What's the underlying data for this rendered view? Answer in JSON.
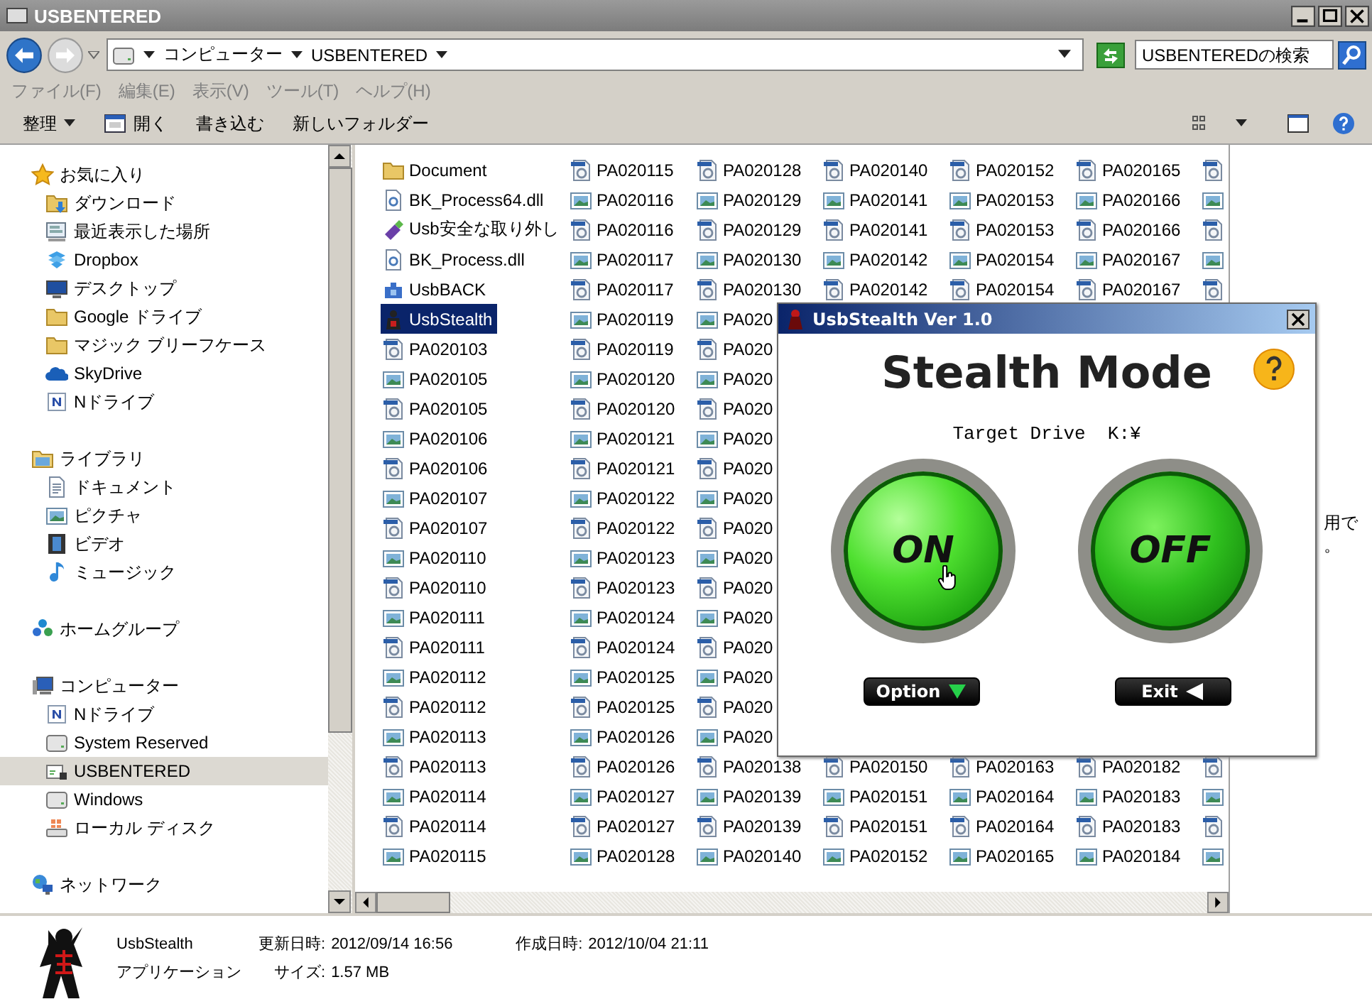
{
  "window": {
    "title": "USBENTERED"
  },
  "address": {
    "crumbs": [
      "コンピューター",
      "USBENTERED"
    ]
  },
  "search": {
    "placeholder": "USBENTEREDの検索"
  },
  "menu": [
    "ファイル(F)",
    "編集(E)",
    "表示(V)",
    "ツール(T)",
    "ヘルプ(H)"
  ],
  "toolbar": [
    {
      "label": "整理",
      "kind": "dropdown"
    },
    {
      "label": "開く",
      "kind": "open"
    },
    {
      "label": "書き込む",
      "kind": "plain"
    },
    {
      "label": "新しいフォルダー",
      "kind": "plain"
    }
  ],
  "sidebar": {
    "groups": [
      {
        "label": "お気に入り",
        "kind": "star",
        "selected": false,
        "children": [
          {
            "label": "ダウンロード",
            "kind": "download",
            "selected": false
          },
          {
            "label": "最近表示した場所",
            "kind": "recent",
            "selected": false
          },
          {
            "label": "Dropbox",
            "kind": "box",
            "selected": false
          },
          {
            "label": "デスクトップ",
            "kind": "desktop",
            "selected": false
          },
          {
            "label": "Google ドライブ",
            "kind": "folder",
            "selected": false
          },
          {
            "label": "マジック ブリーフケース",
            "kind": "folder",
            "selected": false
          },
          {
            "label": "SkyDrive",
            "kind": "cloud",
            "selected": false
          },
          {
            "label": "Nドライブ",
            "kind": "ndrive",
            "selected": false
          }
        ]
      },
      {
        "label": "ライブラリ",
        "kind": "library",
        "selected": false,
        "children": [
          {
            "label": "ドキュメント",
            "kind": "document",
            "selected": false
          },
          {
            "label": "ピクチャ",
            "kind": "picture",
            "selected": false
          },
          {
            "label": "ビデオ",
            "kind": "video",
            "selected": false
          },
          {
            "label": "ミュージック",
            "kind": "music",
            "selected": false
          }
        ]
      },
      {
        "label": "ホームグループ",
        "kind": "homegroup",
        "selected": false
      },
      {
        "label": "コンピューター",
        "kind": "computer",
        "selected": false,
        "children": [
          {
            "label": "Nドライブ",
            "kind": "ndrive",
            "selected": false
          },
          {
            "label": "System Reserved",
            "kind": "drive",
            "selected": false
          },
          {
            "label": "USBENTERED",
            "kind": "usbdrive",
            "selected": true
          },
          {
            "label": "Windows",
            "kind": "drive",
            "selected": false
          },
          {
            "label": "ローカル ディスク",
            "kind": "localdisk",
            "selected": false
          }
        ]
      },
      {
        "label": "ネットワーク",
        "kind": "network",
        "selected": false
      }
    ]
  },
  "files": {
    "columns": [
      {
        "items": [
          {
            "name": "Document",
            "kind": "folder",
            "selected": false
          },
          {
            "name": "BK_Process64.dll",
            "kind": "dll",
            "selected": false
          },
          {
            "name": "Usb安全な取り外し",
            "kind": "usb",
            "selected": false
          },
          {
            "name": "BK_Process.dll",
            "kind": "dll",
            "selected": false
          },
          {
            "name": "UsbBACK",
            "kind": "app",
            "selected": false
          },
          {
            "name": "UsbStealth",
            "kind": "ninja",
            "selected": true
          },
          {
            "name": "PA020103",
            "kind": "camera",
            "selected": false
          },
          {
            "name": "PA020105",
            "kind": "picture",
            "selected": false
          },
          {
            "name": "PA020105",
            "kind": "camera",
            "selected": false
          },
          {
            "name": "PA020106",
            "kind": "picture",
            "selected": false
          },
          {
            "name": "PA020106",
            "kind": "camera",
            "selected": false
          },
          {
            "name": "PA020107",
            "kind": "picture",
            "selected": false
          },
          {
            "name": "PA020107",
            "kind": "camera",
            "selected": false
          },
          {
            "name": "PA020110",
            "kind": "picture",
            "selected": false
          },
          {
            "name": "PA020110",
            "kind": "camera",
            "selected": false
          },
          {
            "name": "PA020111",
            "kind": "picture",
            "selected": false
          },
          {
            "name": "PA020111",
            "kind": "camera",
            "selected": false
          },
          {
            "name": "PA020112",
            "kind": "picture",
            "selected": false
          },
          {
            "name": "PA020112",
            "kind": "camera",
            "selected": false
          },
          {
            "name": "PA020113",
            "kind": "picture",
            "selected": false
          },
          {
            "name": "PA020113",
            "kind": "camera",
            "selected": false
          },
          {
            "name": "PA020114",
            "kind": "picture",
            "selected": false
          },
          {
            "name": "PA020114",
            "kind": "camera",
            "selected": false
          },
          {
            "name": "PA020115",
            "kind": "picture",
            "selected": false
          }
        ]
      },
      {
        "items": [
          {
            "name": "PA020115",
            "kind": "camera",
            "selected": false
          },
          {
            "name": "PA020116",
            "kind": "picture",
            "selected": false
          },
          {
            "name": "PA020116",
            "kind": "camera",
            "selected": false
          },
          {
            "name": "PA020117",
            "kind": "picture",
            "selected": false
          },
          {
            "name": "PA020117",
            "kind": "camera",
            "selected": false
          },
          {
            "name": "PA020119",
            "kind": "picture",
            "selected": false
          },
          {
            "name": "PA020119",
            "kind": "camera",
            "selected": false
          },
          {
            "name": "PA020120",
            "kind": "picture",
            "selected": false
          },
          {
            "name": "PA020120",
            "kind": "camera",
            "selected": false
          },
          {
            "name": "PA020121",
            "kind": "picture",
            "selected": false
          },
          {
            "name": "PA020121",
            "kind": "camera",
            "selected": false
          },
          {
            "name": "PA020122",
            "kind": "picture",
            "selected": false
          },
          {
            "name": "PA020122",
            "kind": "camera",
            "selected": false
          },
          {
            "name": "PA020123",
            "kind": "picture",
            "selected": false
          },
          {
            "name": "PA020123",
            "kind": "camera",
            "selected": false
          },
          {
            "name": "PA020124",
            "kind": "picture",
            "selected": false
          },
          {
            "name": "PA020124",
            "kind": "camera",
            "selected": false
          },
          {
            "name": "PA020125",
            "kind": "picture",
            "selected": false
          },
          {
            "name": "PA020125",
            "kind": "camera",
            "selected": false
          },
          {
            "name": "PA020126",
            "kind": "picture",
            "selected": false
          },
          {
            "name": "PA020126",
            "kind": "camera",
            "selected": false
          },
          {
            "name": "PA020127",
            "kind": "picture",
            "selected": false
          },
          {
            "name": "PA020127",
            "kind": "camera",
            "selected": false
          },
          {
            "name": "PA020128",
            "kind": "picture",
            "selected": false
          }
        ]
      },
      {
        "items": [
          {
            "name": "PA020128",
            "kind": "camera",
            "selected": false
          },
          {
            "name": "PA020129",
            "kind": "picture",
            "selected": false
          },
          {
            "name": "PA020129",
            "kind": "camera",
            "selected": false
          },
          {
            "name": "PA020130",
            "kind": "picture",
            "selected": false
          },
          {
            "name": "PA020130",
            "kind": "camera",
            "selected": false
          },
          {
            "name": "PA020",
            "kind": "picture",
            "selected": false
          },
          {
            "name": "PA020",
            "kind": "camera",
            "selected": false
          },
          {
            "name": "PA020",
            "kind": "picture",
            "selected": false
          },
          {
            "name": "PA020",
            "kind": "camera",
            "selected": false
          },
          {
            "name": "PA020",
            "kind": "picture",
            "selected": false
          },
          {
            "name": "PA020",
            "kind": "camera",
            "selected": false
          },
          {
            "name": "PA020",
            "kind": "picture",
            "selected": false
          },
          {
            "name": "PA020",
            "kind": "camera",
            "selected": false
          },
          {
            "name": "PA020",
            "kind": "picture",
            "selected": false
          },
          {
            "name": "PA020",
            "kind": "camera",
            "selected": false
          },
          {
            "name": "PA020",
            "kind": "picture",
            "selected": false
          },
          {
            "name": "PA020",
            "kind": "camera",
            "selected": false
          },
          {
            "name": "PA020",
            "kind": "picture",
            "selected": false
          },
          {
            "name": "PA020",
            "kind": "camera",
            "selected": false
          },
          {
            "name": "PA020",
            "kind": "picture",
            "selected": false
          },
          {
            "name": "PA020138",
            "kind": "camera",
            "selected": false
          },
          {
            "name": "PA020139",
            "kind": "picture",
            "selected": false
          },
          {
            "name": "PA020139",
            "kind": "camera",
            "selected": false
          },
          {
            "name": "PA020140",
            "kind": "picture",
            "selected": false
          }
        ]
      },
      {
        "items": [
          {
            "name": "PA020140",
            "kind": "camera",
            "selected": false
          },
          {
            "name": "PA020141",
            "kind": "picture",
            "selected": false
          },
          {
            "name": "PA020141",
            "kind": "camera",
            "selected": false
          },
          {
            "name": "PA020142",
            "kind": "picture",
            "selected": false
          },
          {
            "name": "PA020142",
            "kind": "camera",
            "selected": false
          }
        ],
        "bottom_items": [
          {
            "name": "PA020150",
            "kind": "camera",
            "selected": false
          },
          {
            "name": "PA020151",
            "kind": "picture",
            "selected": false
          },
          {
            "name": "PA020151",
            "kind": "camera",
            "selected": false
          },
          {
            "name": "PA020152",
            "kind": "picture",
            "selected": false
          }
        ]
      },
      {
        "items": [
          {
            "name": "PA020152",
            "kind": "camera",
            "selected": false
          },
          {
            "name": "PA020153",
            "kind": "picture",
            "selected": false
          },
          {
            "name": "PA020153",
            "kind": "camera",
            "selected": false
          },
          {
            "name": "PA020154",
            "kind": "picture",
            "selected": false
          },
          {
            "name": "PA020154",
            "kind": "camera",
            "selected": false
          }
        ],
        "bottom_items": [
          {
            "name": "PA020163",
            "kind": "camera",
            "selected": false
          },
          {
            "name": "PA020164",
            "kind": "picture",
            "selected": false
          },
          {
            "name": "PA020164",
            "kind": "camera",
            "selected": false
          },
          {
            "name": "PA020165",
            "kind": "picture",
            "selected": false
          }
        ]
      },
      {
        "items": [
          {
            "name": "PA020165",
            "kind": "camera",
            "selected": false
          },
          {
            "name": "PA020166",
            "kind": "picture",
            "selected": false
          },
          {
            "name": "PA020166",
            "kind": "camera",
            "selected": false
          },
          {
            "name": "PA020167",
            "kind": "picture",
            "selected": false
          },
          {
            "name": "PA020167",
            "kind": "camera",
            "selected": false
          }
        ],
        "bottom_items": [
          {
            "name": "PA020182",
            "kind": "camera",
            "selected": false
          },
          {
            "name": "PA020183",
            "kind": "picture",
            "selected": false
          },
          {
            "name": "PA020183",
            "kind": "camera",
            "selected": false
          },
          {
            "name": "PA020184",
            "kind": "picture",
            "selected": false
          }
        ]
      },
      {
        "items": [
          {
            "kind": "camera",
            "selected": false
          },
          {
            "kind": "picture",
            "selected": false
          },
          {
            "kind": "camera",
            "selected": false
          },
          {
            "kind": "picture",
            "selected": false
          },
          {
            "kind": "camera",
            "selected": false
          }
        ],
        "bottom_items": [
          {
            "kind": "camera",
            "selected": false
          },
          {
            "kind": "picture",
            "selected": false
          },
          {
            "kind": "camera",
            "selected": false
          },
          {
            "kind": "picture",
            "selected": false
          }
        ]
      }
    ]
  },
  "preview": {
    "lines": [
      "用で",
      "。"
    ]
  },
  "dialog": {
    "title": "UsbStealth Ver 1.0",
    "heading": "Stealth Mode",
    "target": "Target Drive  K:¥",
    "switches": [
      {
        "label": "ON",
        "selected": true
      },
      {
        "label": "OFF",
        "selected": false
      }
    ],
    "buttons": [
      {
        "label": "Option",
        "kind": "option"
      },
      {
        "label": "Exit",
        "kind": "exit"
      }
    ]
  },
  "details": {
    "name": "UsbStealth",
    "type": "アプリケーション",
    "fields": [
      {
        "label": "更新日時:",
        "value": "2012/09/14 16:56"
      },
      {
        "label": "作成日時:",
        "value": "2012/10/04 21:11"
      },
      {
        "label": "サイズ:",
        "value": "1.57 MB"
      }
    ]
  }
}
